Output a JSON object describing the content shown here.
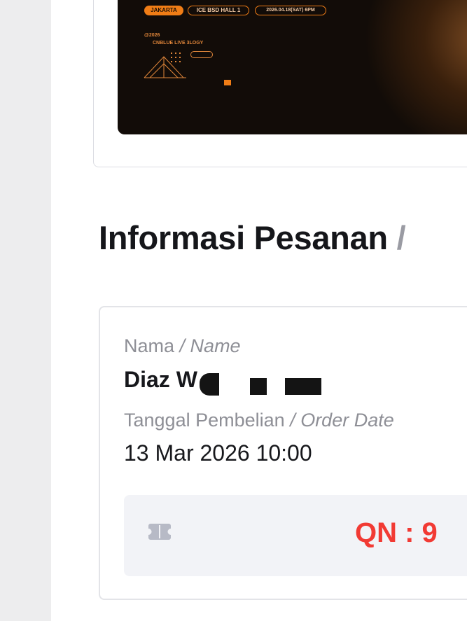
{
  "poster": {
    "city": "JAKARTA",
    "venue": "ICE BSD HALL 1",
    "date": "2026.04.18(SAT) 6PM",
    "year": "@2026",
    "tour_name": "CNBLUE LIVE 3LOGY"
  },
  "order": {
    "section_title": "Informasi Pesanan",
    "section_title_slash": "/",
    "name_label": "Nama",
    "name_label_en": "/ Name",
    "name_value": "Diaz W",
    "date_label": "Tanggal Pembelian",
    "date_label_en": "/ Order Date",
    "date_value": "13 Mar 2026 10:00",
    "queue_number": "QN : 9"
  },
  "colors": {
    "accent_orange": "#f07d16",
    "queue_red": "#f23a34",
    "background_gray": "#ededee"
  },
  "icons": {
    "ticket": "ticket-icon"
  }
}
